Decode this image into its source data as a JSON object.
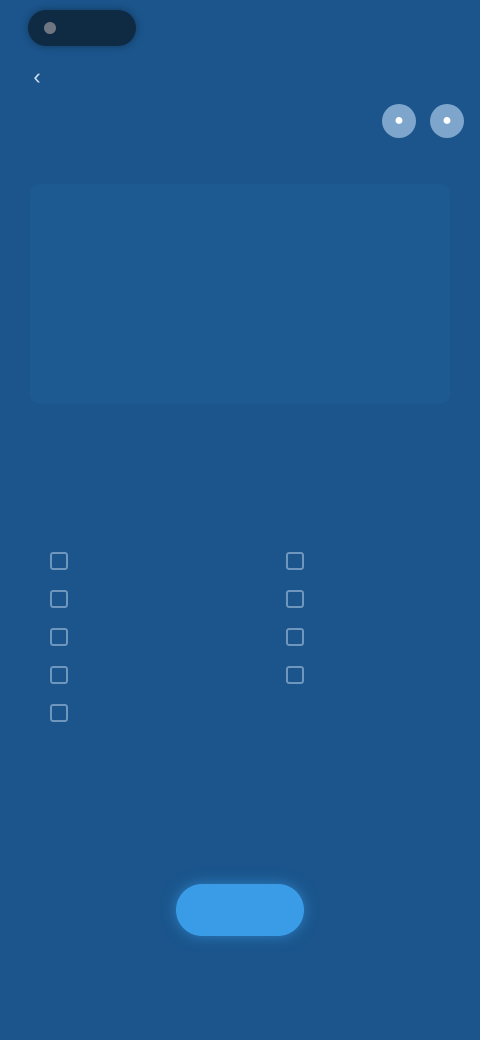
{
  "header": {
    "back_glyph": "‹",
    "title": ""
  },
  "actions": {
    "left_glyph": "●",
    "right_glyph": "●"
  },
  "section_one": {
    "label": ""
  },
  "scores": {
    "left": [
      "",
      "",
      "",
      "",
      ""
    ],
    "right": [
      "",
      "",
      "",
      "",
      ""
    ],
    "center": ""
  },
  "section_two": {
    "label": ""
  },
  "options": {
    "left": [
      "",
      "",
      "",
      "",
      ""
    ],
    "right": [
      "",
      "",
      "",
      ""
    ]
  },
  "cta": {
    "label": ""
  },
  "colors": {
    "background": "#1b558c",
    "accent": "#3a9be6",
    "highlight": "#a8c67c"
  }
}
